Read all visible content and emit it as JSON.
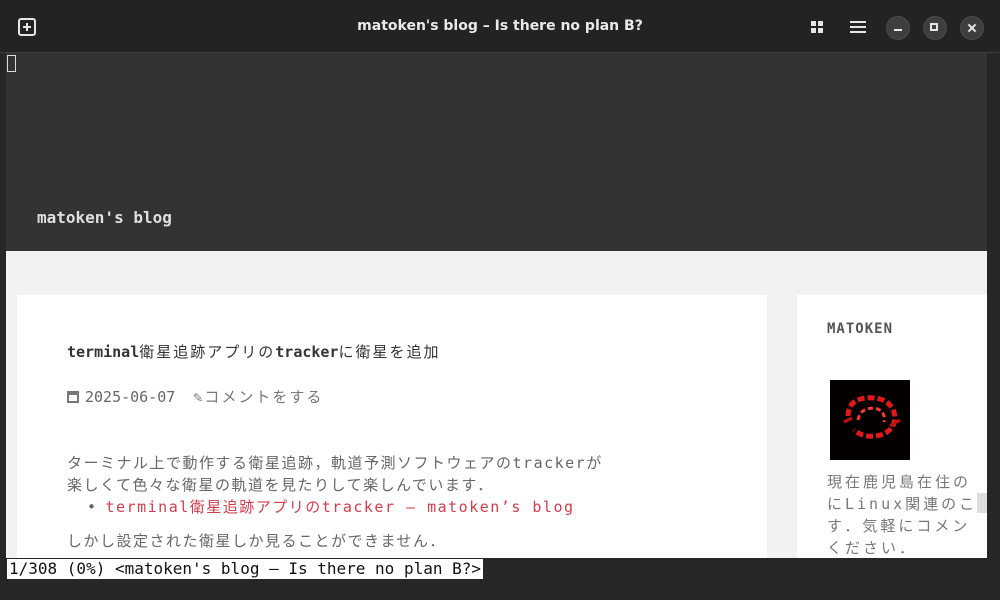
{
  "window": {
    "title": "matoken's blog – Is there no plan B?"
  },
  "icons": {
    "new_tab": "plus-square-icon",
    "layout": "grid-icon",
    "menu": "hamburger-menu-icon",
    "minimize": "minimize-icon",
    "maximize": "maximize-icon",
    "close": "close-icon",
    "date": "calendar-icon"
  },
  "header": {
    "site_title": "matoken's blog"
  },
  "post": {
    "title_ascii1": "terminal",
    "title_jp1": "衛星追跡アプリの",
    "title_ascii2": "tracker",
    "title_jp2": "に衛星を追加",
    "date": "2025-06-07",
    "comment": "✎コメントをする",
    "para1_line1": "ターミナル上で動作する衛星追跡，軌道予測ソフトウェアのtrackerが",
    "para1_line2": "楽しくて色々な衛星の軌道を見たりして楽しんでいます．",
    "link_bullet": "•",
    "link_text": "terminal衛星追跡アプリのtracker – matoken’s blog",
    "para2": "しかし設定された衛星しか見ることができません．"
  },
  "sidebar": {
    "widget_title": "MATOKEN",
    "bio_line1": "現在鹿児島在住の",
    "bio_line2": "にLinux関連のこ",
    "bio_line3": "す．気軽にコメン",
    "bio_line4": "ください．"
  },
  "statusbar": {
    "text": "1/308 (0%) <matoken's blog – Is there no plan B?>"
  },
  "colors": {
    "header_bg": "#333333",
    "link": "#d33c4a",
    "page_bg": "#f2f2f2"
  }
}
